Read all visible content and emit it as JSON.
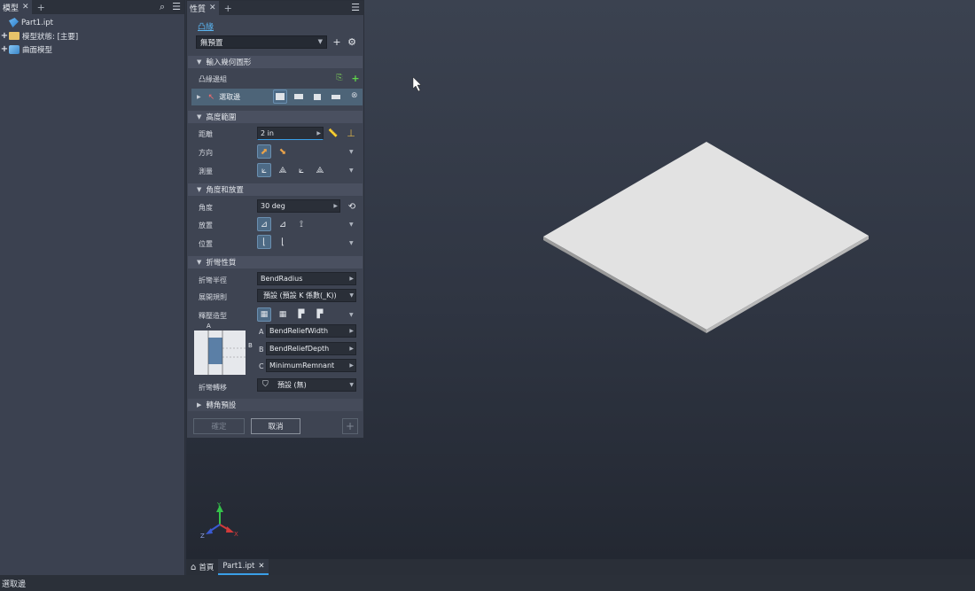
{
  "browser": {
    "tab_label": "模型",
    "tree": [
      {
        "label": "Part1.ipt"
      },
      {
        "label": "模型狀態: [主要]"
      },
      {
        "label": "曲面模型"
      }
    ]
  },
  "properties": {
    "tab_label": "性質",
    "breadcrumb": "凸緣",
    "preset_value": "無預置",
    "sections": {
      "input_geometry": "輸入幾何圖形",
      "height_range": "高度範圍",
      "angle_placement": "角度和放置",
      "bend_properties": "折彎性質",
      "corner_preset": "轉角預設"
    },
    "input_geometry": {
      "edge_group_label": "凸緣邊組",
      "select_edge_label": "選取邊"
    },
    "height": {
      "distance_label": "距離",
      "distance_value": "2 in",
      "direction_label": "方向",
      "measure_label": "測量"
    },
    "angle": {
      "angle_label": "角度",
      "angle_value": "30 deg",
      "placement_label": "放置",
      "position_label": "位置"
    },
    "bend": {
      "radius_label": "折彎半徑",
      "radius_value": "BendRadius",
      "unfold_label": "展開規則",
      "unfold_value": "預設 (預設 K 係數(_K))",
      "relief_shape_label": "釋壓造型",
      "relief_width_key": "A",
      "relief_width_value": "BendReliefWidth",
      "relief_depth_key": "B",
      "relief_depth_value": "BendReliefDepth",
      "min_remnant_key": "C",
      "min_remnant_value": "MinimumRemnant",
      "transition_label": "折彎轉移",
      "transition_value": "預設 (無)"
    },
    "ok_label": "確定",
    "cancel_label": "取消"
  },
  "doc_tabs": {
    "home_label": "首頁",
    "part_label": "Part1.ipt"
  },
  "status_text": "選取邊",
  "colors": {
    "accent": "#3a9fe8",
    "plate": "#e4e4e4"
  }
}
